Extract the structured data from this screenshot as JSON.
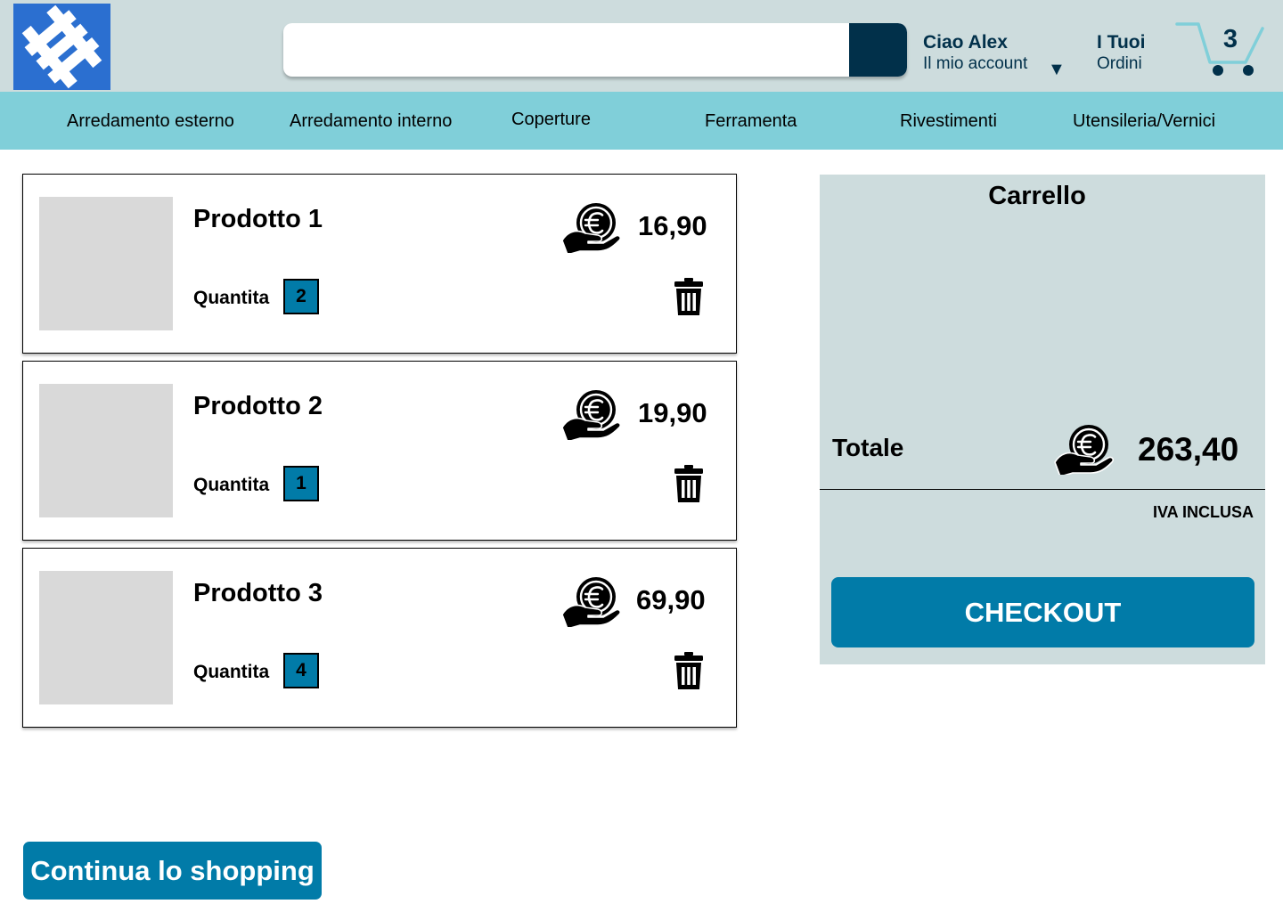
{
  "header": {
    "logo_icon": "brand-logo-icon",
    "search": {
      "value": "",
      "placeholder": ""
    },
    "account": {
      "greeting": "Ciao Alex",
      "link": "Il mio account",
      "caret": "▼"
    },
    "orders": {
      "line1": "I Tuoi",
      "line2": "Ordini"
    },
    "cart": {
      "count": "3",
      "icon": "shopping-cart-icon"
    }
  },
  "nav": {
    "items": [
      "Arredamento esterno",
      "Arredamento interno",
      "Coperture",
      "Ferramenta",
      "Rivestimenti",
      "Utensileria/Vernici"
    ]
  },
  "products": [
    {
      "name": "Prodotto 1",
      "quantity_label": "Quantita",
      "quantity": "2",
      "price": "16,90"
    },
    {
      "name": "Prodotto 2",
      "quantity_label": "Quantita",
      "quantity": "1",
      "price": "19,90"
    },
    {
      "name": "Prodotto 3",
      "quantity_label": "Quantita",
      "quantity": "4",
      "price": "69,90"
    }
  ],
  "summary": {
    "title": "Carrello",
    "total_label": "Totale",
    "total_value": "263,40",
    "vat_note": "IVA INCLUSA",
    "checkout_label": "CHECKOUT"
  },
  "continue_label": "Continua lo shopping",
  "colors": {
    "header_bg": "#cddcdd",
    "nav_bg": "#80cfd9",
    "accent": "#017ba8",
    "dark_navy": "#01304a",
    "logo_blue": "#2b6fd0"
  }
}
